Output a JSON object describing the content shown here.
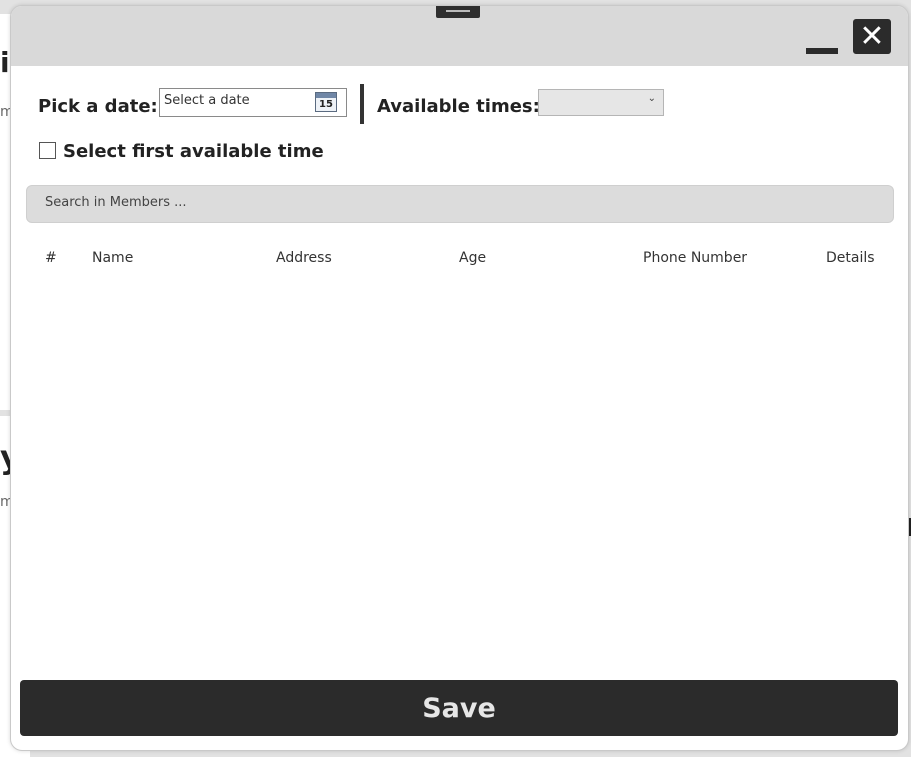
{
  "background": {
    "fragment_1": "i",
    "fragment_2": "m",
    "fragment_3": "y",
    "fragment_4": "m"
  },
  "dialog": {
    "close_label": "✕",
    "date": {
      "label": "Pick a date:",
      "placeholder": "Select a date",
      "calendar_day": "15"
    },
    "times": {
      "label": "Available times:",
      "selected": ""
    },
    "first_available": {
      "label": "Select first available time",
      "checked": false
    },
    "search": {
      "placeholder": "Search in Members ..."
    },
    "table": {
      "columns": [
        "#",
        "Name",
        "Address",
        "Age",
        "Phone Number",
        "Details"
      ],
      "rows": []
    },
    "save_label": "Save"
  }
}
